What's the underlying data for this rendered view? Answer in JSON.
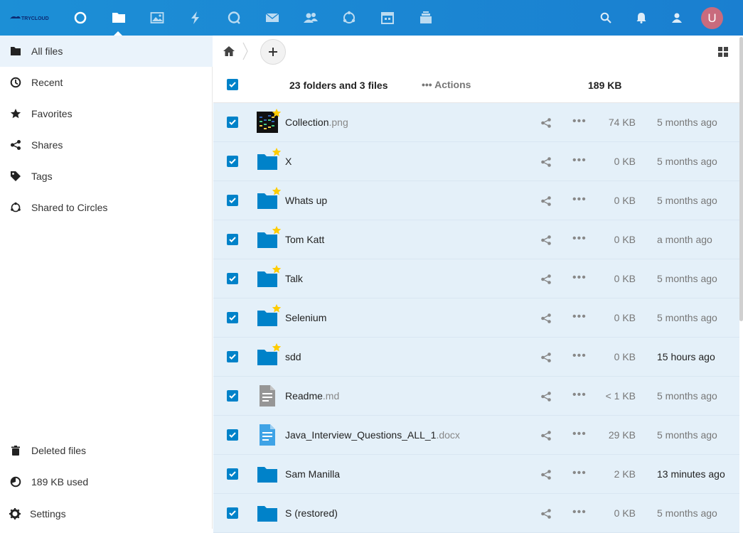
{
  "header": {
    "logo_text": "TRYCLOUD",
    "apps": [
      {
        "name": "dashboard-icon"
      },
      {
        "name": "files-icon"
      },
      {
        "name": "photos-icon"
      },
      {
        "name": "activity-icon"
      },
      {
        "name": "talk-icon"
      },
      {
        "name": "mail-icon"
      },
      {
        "name": "contacts-icon"
      },
      {
        "name": "circles-icon"
      },
      {
        "name": "calendar-icon"
      },
      {
        "name": "deck-icon"
      }
    ],
    "right": [
      "search-icon",
      "notifications-icon",
      "contacts-menu-icon"
    ],
    "avatar_letter": "U",
    "avatar_color": "#c96b7d"
  },
  "sidebar": {
    "items": [
      {
        "label": "All files",
        "icon": "folder-icon"
      },
      {
        "label": "Recent",
        "icon": "clock-icon"
      },
      {
        "label": "Favorites",
        "icon": "star-icon"
      },
      {
        "label": "Shares",
        "icon": "share-icon"
      },
      {
        "label": "Tags",
        "icon": "tag-icon"
      },
      {
        "label": "Shared to Circles",
        "icon": "circles-icon"
      }
    ],
    "bottom": [
      {
        "label": "Deleted files",
        "icon": "trash-icon"
      },
      {
        "label": "189 KB used",
        "icon": "quota-icon"
      },
      {
        "label": "Settings",
        "icon": "gear-icon"
      }
    ]
  },
  "main": {
    "summary": "23 folders and 3 files",
    "actions_label": "Actions",
    "total_size": "189 KB",
    "files": [
      {
        "base": "Collection",
        "ext": ".png",
        "type": "image",
        "fav": true,
        "size": "74 KB",
        "date": "5 months ago",
        "recent": false
      },
      {
        "base": "X",
        "ext": "",
        "type": "folder",
        "fav": true,
        "size": "0 KB",
        "date": "5 months ago",
        "recent": false
      },
      {
        "base": "Whats up",
        "ext": "",
        "type": "folder",
        "fav": true,
        "size": "0 KB",
        "date": "5 months ago",
        "recent": false
      },
      {
        "base": "Tom Katt",
        "ext": "",
        "type": "folder",
        "fav": true,
        "size": "0 KB",
        "date": "a month ago",
        "recent": false
      },
      {
        "base": "Talk",
        "ext": "",
        "type": "folder",
        "fav": true,
        "size": "0 KB",
        "date": "5 months ago",
        "recent": false
      },
      {
        "base": "Selenium",
        "ext": "",
        "type": "folder",
        "fav": true,
        "size": "0 KB",
        "date": "5 months ago",
        "recent": false
      },
      {
        "base": "sdd",
        "ext": "",
        "type": "folder",
        "fav": true,
        "size": "0 KB",
        "date": "15 hours ago",
        "recent": true
      },
      {
        "base": "Readme",
        "ext": ".md",
        "type": "text",
        "fav": false,
        "size": "< 1 KB",
        "date": "5 months ago",
        "recent": false
      },
      {
        "base": "Java_Interview_Questions_ALL_1",
        "ext": ".docx",
        "type": "doc",
        "fav": false,
        "size": "29 KB",
        "date": "5 months ago",
        "recent": false
      },
      {
        "base": "Sam Manilla",
        "ext": "",
        "type": "folder",
        "fav": false,
        "size": "2 KB",
        "date": "13 minutes ago",
        "recent": true
      },
      {
        "base": "S (restored)",
        "ext": "",
        "type": "folder",
        "fav": false,
        "size": "0 KB",
        "date": "5 months ago",
        "recent": false
      }
    ]
  },
  "colors": {
    "accent": "#0082c9",
    "header": "#1a86d3",
    "selected_row": "#e4f0f9",
    "star": "#fc0"
  }
}
